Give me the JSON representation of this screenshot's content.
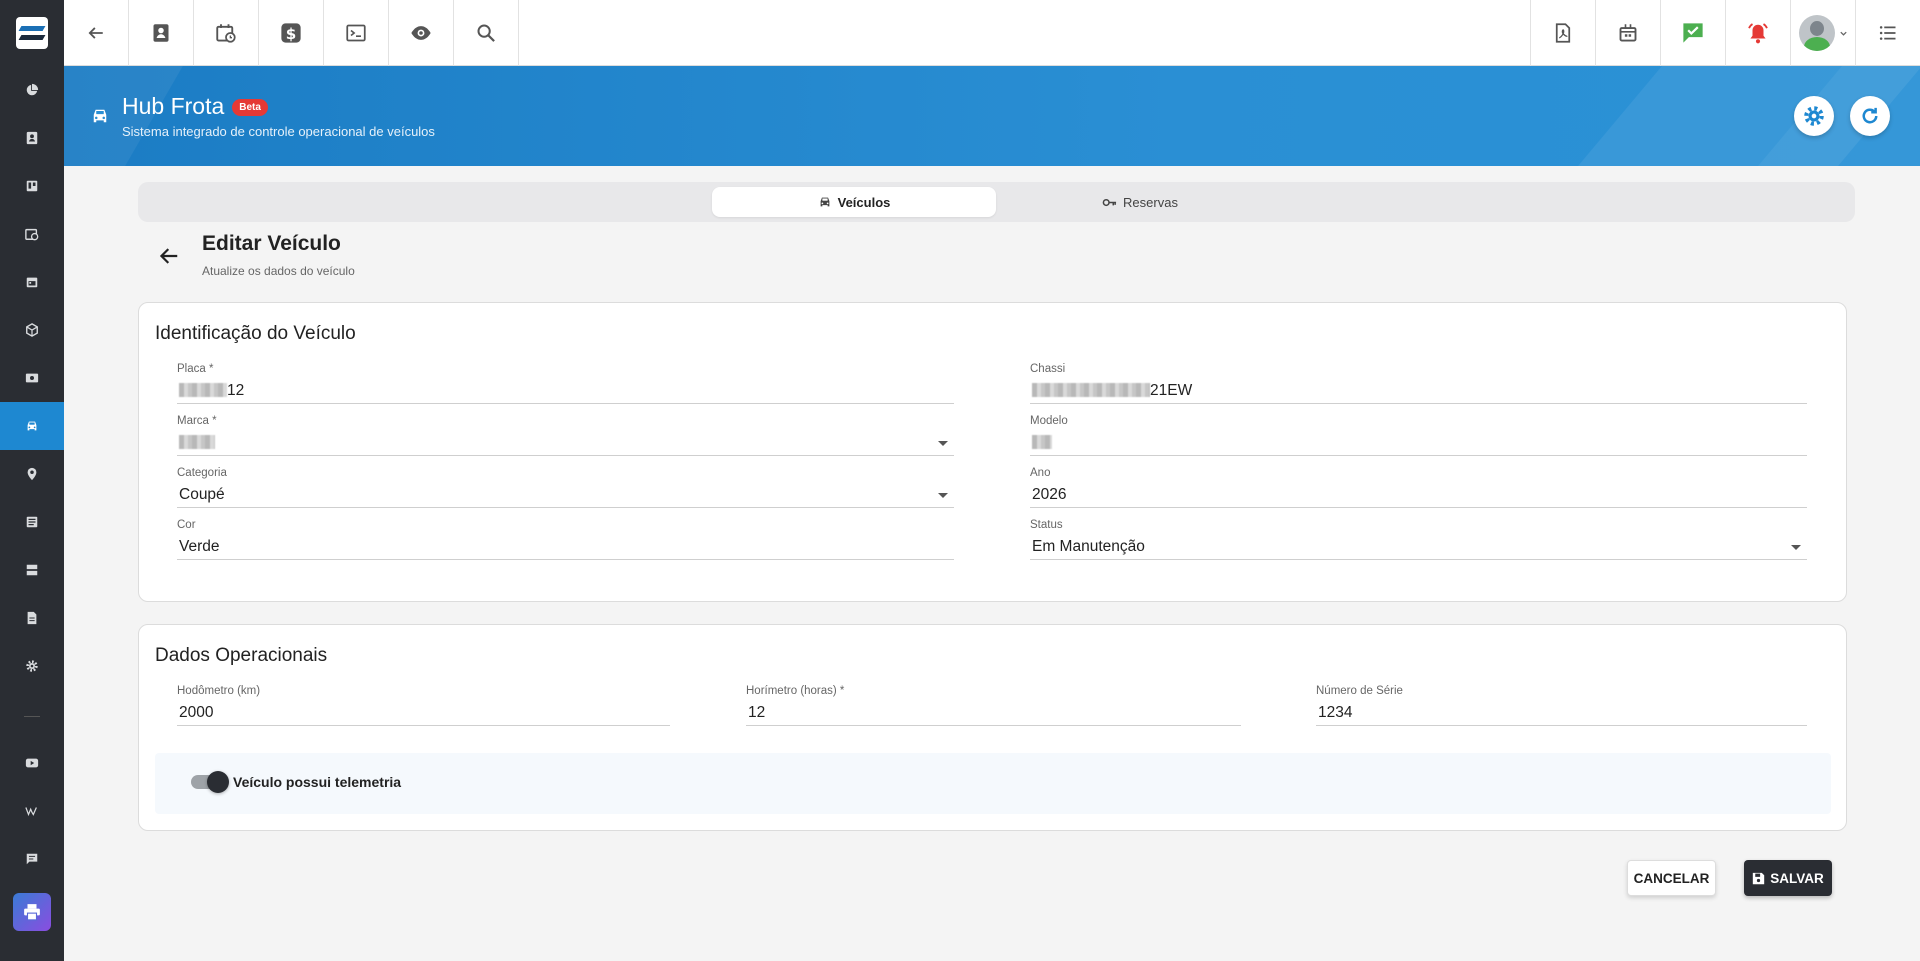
{
  "topbar": {
    "left_icons": [
      "back-arrow-icon",
      "contact-card-icon",
      "calendar-clock-icon",
      "dollar-icon",
      "terminal-icon",
      "eye-icon",
      "search-icon"
    ],
    "right_icons": [
      "pdf-file-icon",
      "calendar-building-icon",
      "chat-check-icon",
      "alarm-bell-icon",
      "user-avatar",
      "list-menu-icon"
    ],
    "colors": {
      "chat_check": "#4caf50",
      "alarm": "#e53935"
    }
  },
  "sidebar": {
    "items": [
      "chart-pie-icon",
      "contact-icon",
      "board-icon",
      "calendar-clock-icon",
      "calendar-icon",
      "package-icon",
      "money-icon",
      "car-icon",
      "map-pin-icon",
      "document-list-icon",
      "server-icon",
      "file-icon",
      "gear-icon",
      "youtube-icon",
      "wiki-icon",
      "chat-icon",
      "printer-icon"
    ],
    "active": "car-icon",
    "accent": "#1e88d1"
  },
  "header": {
    "title": "Hub Frota",
    "badge": "Beta",
    "subtitle": "Sistema integrado de controle operacional de veículos"
  },
  "tabs": [
    {
      "label": "Veículos",
      "icon": "car-icon",
      "active": true
    },
    {
      "label": "Reservas",
      "icon": "key-icon",
      "active": false
    }
  ],
  "page": {
    "title": "Editar Veículo",
    "subtitle": "Atualize os dados do veículo"
  },
  "identificacao": {
    "title": "Identificação do Veículo",
    "placa": {
      "label": "Placa *",
      "value": "12"
    },
    "chassi": {
      "label": "Chassi",
      "value": "21EW"
    },
    "marca": {
      "label": "Marca *",
      "value": ""
    },
    "modelo": {
      "label": "Modelo",
      "value": ""
    },
    "categoria": {
      "label": "Categoria",
      "value": "Coupé"
    },
    "ano": {
      "label": "Ano",
      "value": "2026"
    },
    "cor": {
      "label": "Cor",
      "value": "Verde"
    },
    "status": {
      "label": "Status",
      "value": "Em Manutenção"
    }
  },
  "operacionais": {
    "title": "Dados Operacionais",
    "hodometro": {
      "label": "Hodômetro (km)",
      "value": "2000"
    },
    "horimetro": {
      "label": "Horímetro (horas) *",
      "value": "12"
    },
    "numero_serie": {
      "label": "Número de Série",
      "value": "1234"
    },
    "telemetria": {
      "label": "Veículo possui telemetria",
      "enabled": true
    }
  },
  "actions": {
    "cancel": "CANCELAR",
    "save": "SALVAR"
  }
}
